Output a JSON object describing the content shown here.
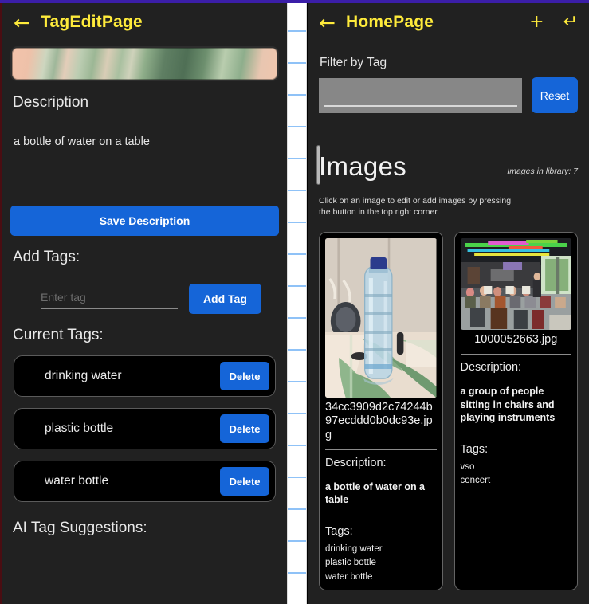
{
  "left_panel": {
    "appbar": {
      "back_icon": "arrow-left-icon",
      "title": "TagEditPage"
    },
    "description_heading": "Description",
    "description_value": "a bottle of water on a table",
    "save_button": "Save Description",
    "add_tags_heading": "Add Tags:",
    "tag_input_placeholder": "Enter tag",
    "tag_input_value": "",
    "add_tag_button": "Add Tag",
    "current_tags_heading": "Current Tags:",
    "tags": [
      {
        "name": "drinking water",
        "delete_label": "Delete"
      },
      {
        "name": "plastic bottle",
        "delete_label": "Delete"
      },
      {
        "name": "water bottle",
        "delete_label": "Delete"
      }
    ],
    "ai_suggestions_heading": "AI Tag Suggestions:"
  },
  "right_panel": {
    "appbar": {
      "back_icon": "arrow-left-icon",
      "title": "HomePage",
      "add_icon": "plus-icon",
      "return_icon": "enter-return-icon"
    },
    "filter_label": "Filter by Tag",
    "filter_placeholder": "",
    "filter_value": "",
    "reset_button": "Reset",
    "images_heading": "Images",
    "library_count": "Images in library: 7",
    "hint": "Click on an image to edit or add images by pressing the button in the top right corner.",
    "cards": [
      {
        "thumbnail": "water-bottle-photo",
        "filename": "34cc3909d2c74244b97ecddd0b0dc93e.jpg",
        "description_label": "Description:",
        "description": "a bottle of water on a table",
        "tags_label": "Tags:",
        "tags": [
          "drinking water",
          "plastic bottle",
          "water bottle"
        ]
      },
      {
        "thumbnail": "orchestra-concert-photo",
        "filename": "1000052663.jpg",
        "description_label": "Description:",
        "description": "a group of people sitting in chairs and playing instruments",
        "tags_label": "Tags:",
        "tags": [
          "vso",
          "concert"
        ]
      }
    ]
  },
  "colors": {
    "accent_yellow": "#ffeb3b",
    "button_blue": "#1565d8",
    "panel_bg": "#212121",
    "card_bg": "#000000",
    "top_accent": "#3b1ea8"
  }
}
